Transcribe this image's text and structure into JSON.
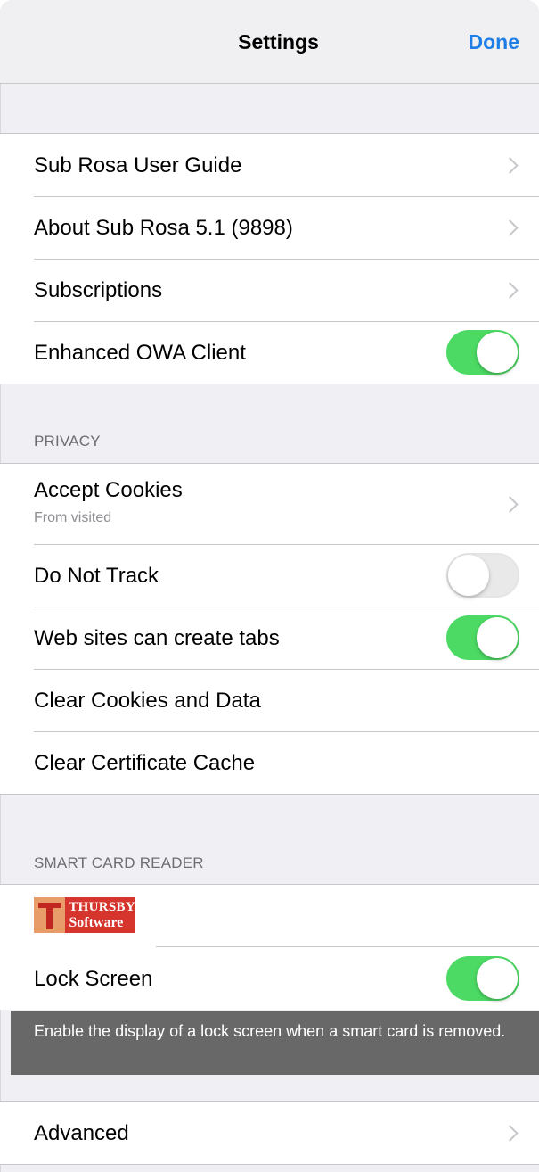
{
  "navbar": {
    "title": "Settings",
    "done_label": "Done"
  },
  "general": {
    "items": [
      {
        "label": "Sub Rosa User Guide",
        "accessory": "chevron"
      },
      {
        "label": "About Sub Rosa 5.1 (9898)",
        "accessory": "chevron"
      },
      {
        "label": "Subscriptions",
        "accessory": "chevron"
      },
      {
        "label": "Enhanced OWA Client",
        "accessory": "toggle",
        "toggle_on": true
      }
    ]
  },
  "privacy": {
    "header": "PRIVACY",
    "items": [
      {
        "label": "Accept Cookies",
        "sublabel": "From visited",
        "accessory": "chevron"
      },
      {
        "label": "Do Not Track",
        "accessory": "toggle",
        "toggle_on": false
      },
      {
        "label": "Web sites can create tabs",
        "accessory": "toggle",
        "toggle_on": true
      },
      {
        "label": "Clear Cookies and Data"
      },
      {
        "label": "Clear Certificate Cache"
      }
    ]
  },
  "smart_card": {
    "header": "SMART CARD READER",
    "logo": {
      "line1": "THURSBY",
      "line2": "Software"
    },
    "items": [
      {
        "label": "Lock Screen",
        "accessory": "toggle",
        "toggle_on": true
      }
    ],
    "footnote": "Enable the display of a lock screen when a smart card is removed."
  },
  "advanced": {
    "items": [
      {
        "label": "Advanced",
        "accessory": "chevron"
      }
    ]
  },
  "colors": {
    "accent": "#1e7ee6",
    "toggle_on": "#4cd964",
    "background": "#efeff4"
  }
}
